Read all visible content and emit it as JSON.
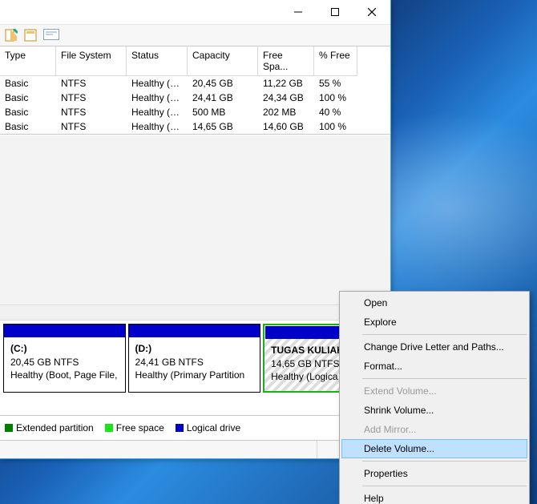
{
  "columns": {
    "type": "Type",
    "filesystem": "File System",
    "status": "Status",
    "capacity": "Capacity",
    "freespace": "Free Spa...",
    "pctfree": "% Free"
  },
  "volumes": [
    {
      "type": "Basic",
      "fs": "NTFS",
      "status": "Healthy (B...",
      "capacity": "20,45 GB",
      "free": "11,22 GB",
      "pct": "55 %"
    },
    {
      "type": "Basic",
      "fs": "NTFS",
      "status": "Healthy (P...",
      "capacity": "24,41 GB",
      "free": "24,34 GB",
      "pct": "100 %"
    },
    {
      "type": "Basic",
      "fs": "NTFS",
      "status": "Healthy (S...",
      "capacity": "500 MB",
      "free": "202 MB",
      "pct": "40 %"
    },
    {
      "type": "Basic",
      "fs": "NTFS",
      "status": "Healthy (L...",
      "capacity": "14,65 GB",
      "free": "14,60 GB",
      "pct": "100 %"
    }
  ],
  "diagram": {
    "c": {
      "title": "(C:)",
      "line2": "20,45 GB NTFS",
      "line3": "Healthy (Boot, Page File,"
    },
    "d": {
      "title": "(D:)",
      "line2": "24,41 GB NTFS",
      "line3": "Healthy (Primary Partition"
    },
    "sel": {
      "title": "TUGAS KULIAH",
      "line2": "14,65 GB NTFS",
      "line3": "Healthy (Logica"
    }
  },
  "legend": {
    "extended": "Extended partition",
    "freespace": "Free space",
    "logical": "Logical drive",
    "colors": {
      "extended": "#008000",
      "freespace": "#19e619",
      "logical": "#0000c8"
    }
  },
  "menu": {
    "open": "Open",
    "explore": "Explore",
    "changeletter": "Change Drive Letter and Paths...",
    "format": "Format...",
    "extend": "Extend Volume...",
    "shrink": "Shrink Volume...",
    "addmirror": "Add Mirror...",
    "deletevol": "Delete Volume...",
    "properties": "Properties",
    "help": "Help"
  }
}
